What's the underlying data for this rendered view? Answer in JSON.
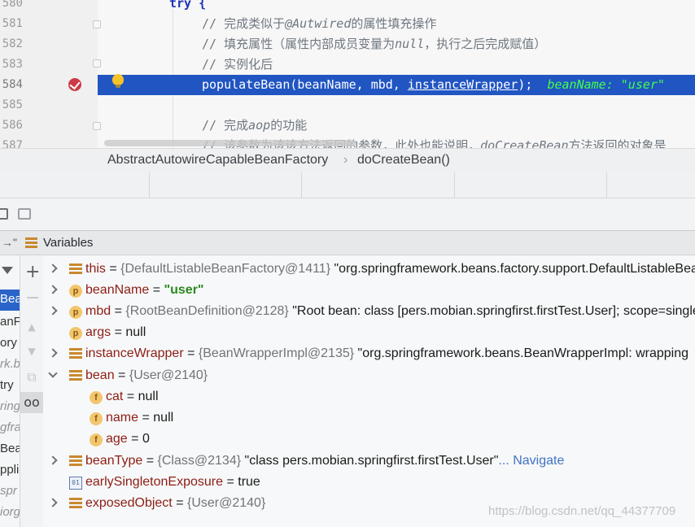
{
  "editor": {
    "lines": [
      {
        "num": "580",
        "code": "try {"
      },
      {
        "num": "581",
        "comment_prefix": "// 完成类似于",
        "comment_em": "@Autwired",
        "comment_suffix": "的属性填充操作"
      },
      {
        "num": "582",
        "comment_prefix": "// 填充属性（属性内部成员变量为",
        "comment_em": "null",
        "comment_suffix": "，执行之后完成赋值）"
      },
      {
        "num": "583",
        "comment_text": "// 实例化后"
      },
      {
        "num": "584",
        "code_pre": "populateBean(beanName, mbd, ",
        "code_under": "instanceWrapper",
        "code_post": ");",
        "hint": "beanName: \"user\""
      },
      {
        "num": "585"
      },
      {
        "num": "586",
        "comment_prefix": "// 完成",
        "comment_em": "aop",
        "comment_suffix": "的功能"
      },
      {
        "num": "587",
        "comment_prefix": "// 该参数为该该方法返回的参数，此处也能说明，",
        "comment_em": "doCreateBean",
        "comment_suffix": "方法返回的对象是"
      }
    ]
  },
  "breadcrumb": {
    "class": "AbstractAutowireCapableBeanFactory",
    "separator": "›",
    "method": "doCreateBean()"
  },
  "variables": {
    "title": "Variables",
    "rows": [
      {
        "name": "this",
        "type": "{DefaultListableBeanFactory@1411}",
        "value": "\"org.springframework.beans.factory.support.DefaultListableBeanFactory"
      },
      {
        "name": "beanName",
        "value": "\"user\""
      },
      {
        "name": "mbd",
        "type": "{RootBeanDefinition@2128}",
        "value": "\"Root bean: class [pers.mobian.springfirst.firstTest.User]; scope=singleton"
      },
      {
        "name": "args",
        "value": "null"
      },
      {
        "name": "instanceWrapper",
        "type": "{BeanWrapperImpl@2135}",
        "value": "\"org.springframework.beans.BeanWrapperImpl: wrapping"
      },
      {
        "name": "bean",
        "type": "{User@2140}"
      },
      {
        "name": "cat",
        "value": "null"
      },
      {
        "name": "name",
        "value": "null"
      },
      {
        "name": "age",
        "value": "0"
      },
      {
        "name": "beanType",
        "type": "{Class@2134}",
        "value": "\"class pers.mobian.springfirst.firstTest.User\"",
        "link": "... Navigate"
      },
      {
        "name": "earlySingletonExposure",
        "value": "true"
      },
      {
        "name": "exposedObject",
        "type": "{User@2140}"
      }
    ],
    "equals": "="
  },
  "left_fragments": [
    "Bea",
    "anFa",
    "ory",
    "rk.b",
    "try",
    "ring",
    "gfra",
    "Bean",
    "ppli",
    "spr",
    "iorg"
  ],
  "side_tools": {
    "plus": "+",
    "minus": "−",
    "up": "▲",
    "down": "▼",
    "copy": "⧉",
    "glasses": "oo"
  },
  "watermark": "https://blog.csdn.net/qq_44377709",
  "colors": {
    "selection": "#2155c2",
    "accent": "#2a64c8"
  }
}
